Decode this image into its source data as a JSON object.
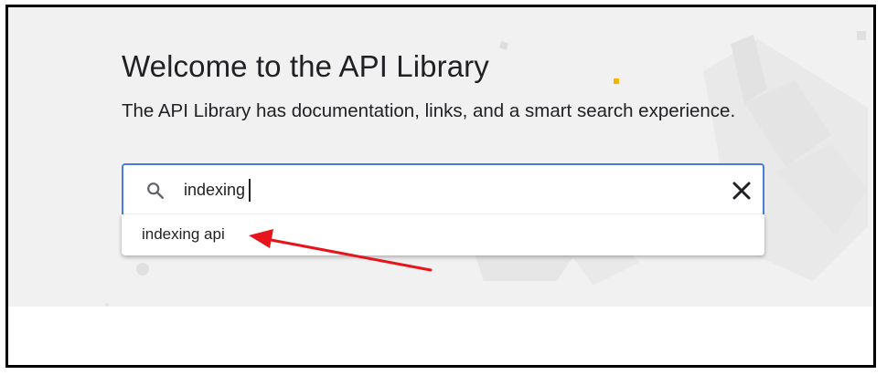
{
  "hero": {
    "title": "Welcome to the API Library",
    "subtitle": "The API Library has documentation, links, and a smart search experience."
  },
  "search": {
    "value": "indexing",
    "icon": "search-icon",
    "clear_icon": "close-icon"
  },
  "suggestions": [
    {
      "label": "indexing api"
    }
  ],
  "colors": {
    "hero_bg": "#f1f1f1",
    "focus_border": "#4a7cdc",
    "annotation_arrow": "#e8141b",
    "accent_sparkle": "#f4b400"
  }
}
